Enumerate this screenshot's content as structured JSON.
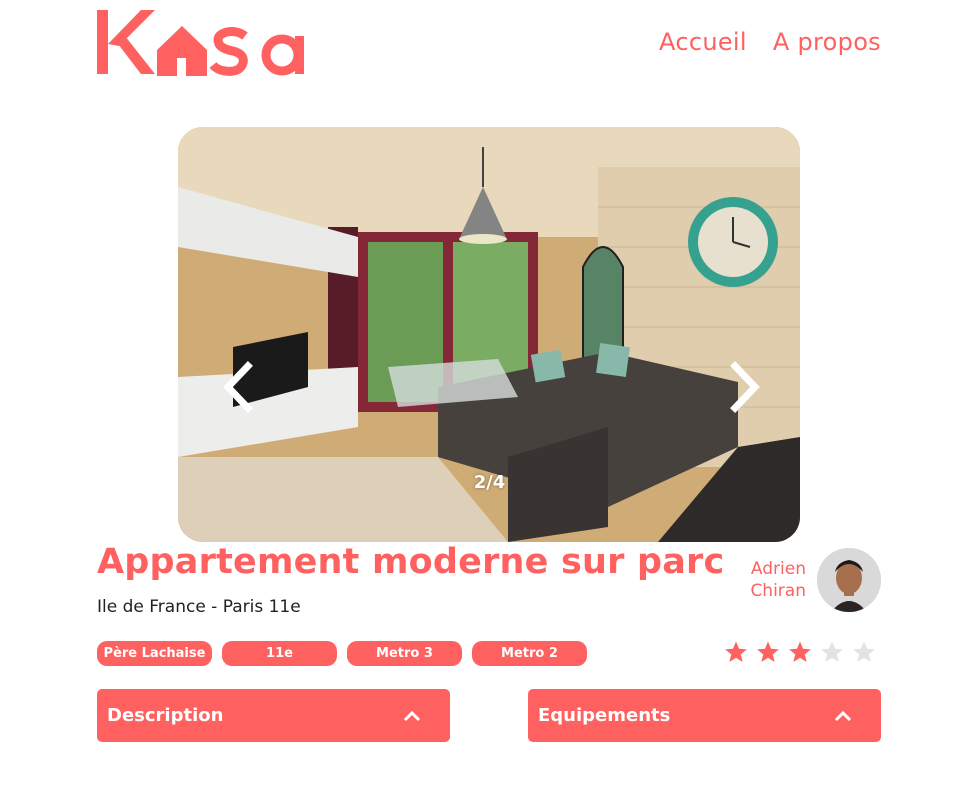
{
  "brand": {
    "name": "Kasa",
    "color": "#FF6060"
  },
  "nav": {
    "home": "Accueil",
    "about": "A propos"
  },
  "carousel": {
    "counter": "2/4",
    "prev_icon": "chevron-left-icon",
    "next_icon": "chevron-right-icon"
  },
  "listing": {
    "title": "Appartement moderne sur parc",
    "location": "Ile de France - Paris 11e",
    "tags": [
      "Père Lachaise",
      "11e",
      "Metro 3",
      "Metro 2"
    ],
    "rating": 3,
    "rating_max": 5
  },
  "host": {
    "first_name": "Adrien",
    "last_name": "Chiran"
  },
  "sections": {
    "description": "Description",
    "equipments": "Equipements"
  }
}
